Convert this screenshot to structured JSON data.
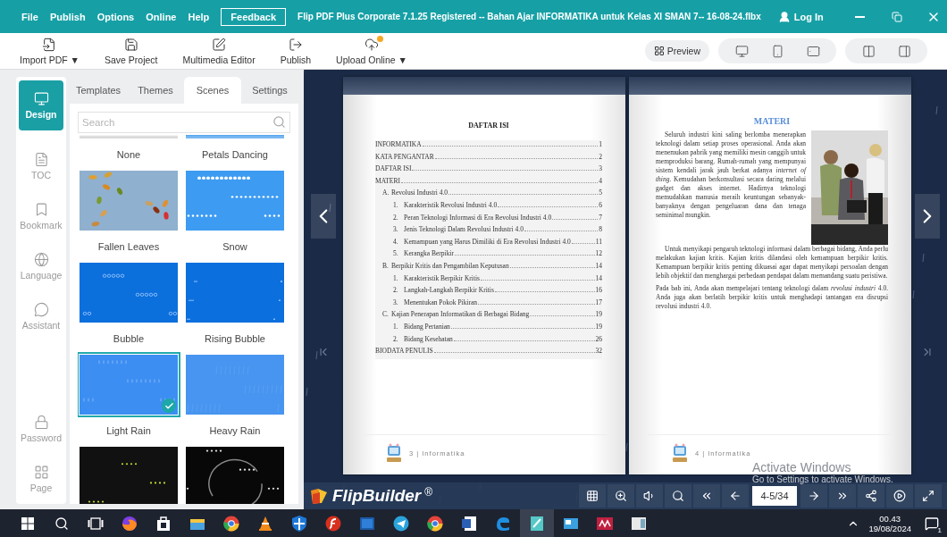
{
  "window": {
    "menus": [
      "File",
      "Publish",
      "Options",
      "Online",
      "Help"
    ],
    "feedback": "Feedback",
    "title": "Flip PDF Plus Corporate 7.1.25 Registered -- Bahan Ajar INFORMATIKA untuk Kelas XI SMAN 7-- 16-08-24.flbx",
    "login": "Log In"
  },
  "toolbar": {
    "tools": [
      {
        "kind": "import",
        "label": "Import PDF ▼",
        "badge": false
      },
      {
        "kind": "save",
        "label": "Save Project",
        "badge": false
      },
      {
        "kind": "edit",
        "label": "Multimedia Editor",
        "badge": false
      },
      {
        "kind": "publish",
        "label": "Publish",
        "badge": false
      },
      {
        "kind": "upload",
        "label": "Upload Online ▼",
        "badge": true
      }
    ],
    "preview": "Preview",
    "devices": [
      {
        "kind": "desktop"
      },
      {
        "kind": "phone"
      },
      {
        "kind": "tablet"
      }
    ],
    "views": [
      {
        "kind": "double"
      },
      {
        "kind": "single"
      }
    ]
  },
  "sidebar": {
    "items": [
      {
        "kind": "design",
        "label": "Design",
        "selected": true
      },
      {
        "kind": "toc",
        "label": "TOC",
        "selected": false
      },
      {
        "kind": "bookmark",
        "label": "Bookmark",
        "selected": false
      },
      {
        "kind": "language",
        "label": "Language",
        "selected": false
      },
      {
        "kind": "assistant",
        "label": "Assistant",
        "selected": false
      },
      {
        "kind": "password",
        "label": "Password",
        "selected": false
      },
      {
        "kind": "page",
        "label": "Page",
        "selected": false
      }
    ]
  },
  "panel": {
    "tabs": [
      {
        "label": "Templates",
        "selected": false
      },
      {
        "label": "Themes",
        "selected": false
      },
      {
        "label": "Scenes",
        "selected": true
      },
      {
        "label": "Settings",
        "selected": false
      }
    ],
    "search": {
      "placeholder": "Search"
    },
    "scenes": [
      {
        "kind": "none",
        "name": "None",
        "selected": false
      },
      {
        "kind": "petals",
        "name": "Petals Dancing",
        "selected": false
      },
      {
        "kind": "leaves",
        "name": "Fallen Leaves",
        "selected": false
      },
      {
        "kind": "snow",
        "name": "Snow",
        "selected": false
      },
      {
        "kind": "bubble",
        "name": "Bubble",
        "selected": false
      },
      {
        "kind": "rising",
        "name": "Rising Bubble",
        "selected": false
      },
      {
        "kind": "rain",
        "name": "Light Rain",
        "selected": true
      },
      {
        "kind": "heavy",
        "name": "Heavy Rain",
        "selected": false
      },
      {
        "kind": "fireflies",
        "selected": false
      },
      {
        "kind": "stars",
        "selected": false
      }
    ]
  },
  "book": {
    "left_page": {
      "heading": "DAFTAR ISI",
      "toc": [
        {
          "label": "INFORMATIKA",
          "page": "1"
        },
        {
          "label": "KATA PENGANTAR",
          "page": "2"
        },
        {
          "label": "DAFTAR ISI",
          "page": "3"
        },
        {
          "label": "MATERI",
          "page": "4",
          "children": [
            {
              "number": "A.",
              "label": "Revolusi Industri 4.0",
              "page": "5",
              "children": [
                {
                  "number": "1.",
                  "label": "Karakteristik Revolusi Industri 4.0",
                  "page": "6"
                },
                {
                  "number": "2.",
                  "label": "Peran Teknologi Informasi di Era Revolusi Industri 4.0",
                  "page": "7"
                },
                {
                  "number": "3.",
                  "label": "Jenis Teknologi Dalam Revolusi Industri 4.0",
                  "page": "8"
                },
                {
                  "number": "4.",
                  "label": "Kemampuan yang Harus Dimiliki di Era Revolusi Industri 4.0",
                  "page": "11"
                },
                {
                  "number": "5.",
                  "label": "Kerangka Berpikir",
                  "page": "12"
                }
              ]
            },
            {
              "number": "B.",
              "label": "Berpikir Kritis dan Pengambilan Keputusan",
              "page": "14",
              "children": [
                {
                  "number": "1.",
                  "label": "Karakteristik Berpikir Kritis",
                  "page": "14"
                },
                {
                  "number": "2.",
                  "label": "Langkah-Langkah Berpikir Kritis",
                  "page": "16"
                },
                {
                  "number": "3.",
                  "label": "Menentukan Pokok Pikiran",
                  "page": "17"
                }
              ]
            },
            {
              "number": "C.",
              "label": "Kajian Penerapan Informatikan di Berbagai Bidang",
              "page": "19",
              "children": [
                {
                  "number": "1.",
                  "label": "Bidang Pertanian",
                  "page": "19"
                },
                {
                  "number": "2.",
                  "label": "Bidang Kesehatan",
                  "page": "26"
                }
              ]
            }
          ]
        },
        {
          "label": "BIODATA PENULIS",
          "page": "32"
        }
      ],
      "footer": "3 | Informatika"
    },
    "right_page": {
      "heading": "MATERI",
      "paragraphs": [
        "Seluruh industri kini saling berlomba menerapkan teknologi dalam setiap proses operasional. Anda akan menemukan pabrik yang memiliki mesin canggih untuk memproduksi barang. Rumah-rumah yang mempunyai sistem kendali jarak jauh berkat adanya *internet of thing*. Kemudahan berkonsultasi secara daring melalui gadget dan akses internet. Hadirnya teknologi memudahkan manusia meraih keuntungan sebanyak-banyaknya dengan pengeluaran dana dan tenaga seminimal mungkin.",
        "Untuk menyikapi pengaruh teknologi informasi dalam berbagai bidang, Anda perlu melakukan kajian kritis. Kajian kritis dilandasi oleh kemampuan berpikir kritis. Kemampuan berpikir kritis penting dikuasai agar dapat menyikapi persoalan dengan lebih objektif dan menghargai perbedaan pendapat dalam memandang suatu peristiwa.",
        "Pada bab ini, Anda akan mempelajari tentang teknologi dalam *revolusi industri* 4.0. Anda juga akan berlatih berpikir kritis untuk menghadapi tantangan era disrupsi revolusi industri 4.0."
      ],
      "footer": "4 | Informatika"
    }
  },
  "notice": {
    "title": "Activate Windows",
    "text": "Go to Settings to activate Windows."
  },
  "controls": {
    "brand": "FlipBuilder",
    "mark": "®",
    "page": "4-5/34"
  },
  "taskbar": {
    "time": "00.43",
    "date": "19/08/2024",
    "notifications": "1"
  }
}
